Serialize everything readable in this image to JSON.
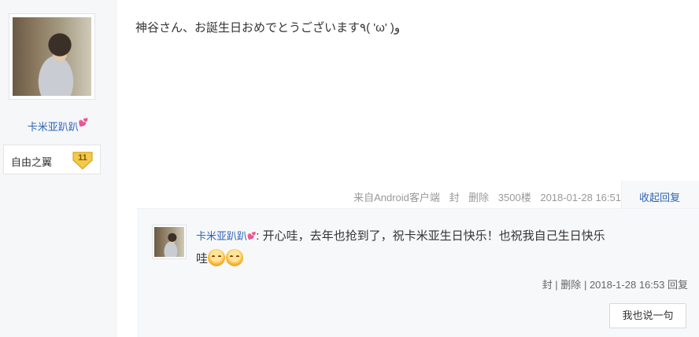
{
  "author": {
    "name": "卡米亚趴趴",
    "heart": "💕",
    "badge_name": "自由之翼",
    "badge_level": "11"
  },
  "post": {
    "text": "神谷さん、お誕生日おめでとうございます٩( 'ω' )و",
    "source": "来自Android客户端",
    "action_seal": "封",
    "action_delete": "删除",
    "floor": "3500楼",
    "datetime": "2018-01-28 16:51",
    "collapse_reply": "收起回复"
  },
  "comment": {
    "user": "卡米亚趴趴",
    "heart": "💕",
    "text_line1": ": 开心哇，去年也抢到了，祝卡米亚生日快乐！也祝我自己生日快乐",
    "text_line2": "哇",
    "emojis": [
      "smile-emoji",
      "smile-emoji"
    ],
    "seal": "封",
    "delete": "删除",
    "datetime": "2018-1-28 16:53",
    "reply": "回复",
    "reply_button": "我也说一句"
  },
  "colors": {
    "link": "#2d64b3",
    "meta": "#999999",
    "badge": "#f2c94c"
  }
}
